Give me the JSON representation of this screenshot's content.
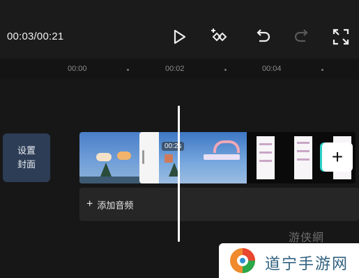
{
  "toolbar": {
    "timecode": "00:03/00:21",
    "icons": [
      "play-icon",
      "keyframe-add-icon",
      "undo-icon",
      "redo-icon",
      "fullscreen-icon"
    ]
  },
  "ruler": {
    "labels": [
      "00:00",
      "00:02",
      "00:04"
    ]
  },
  "cover": {
    "line1": "设置",
    "line2": "封面"
  },
  "video_track": {
    "duration_badge": "00:2s",
    "add_label": "+"
  },
  "audio_track": {
    "plus": "+",
    "label": "添加音频"
  },
  "watermarks": {
    "small": "游侠網",
    "brand": "道宁手游网"
  },
  "colors": {
    "background": "#171717",
    "cover_button": "#2d3d56",
    "selection_border": "#f5f5f5",
    "accent_cyan": "#2ad1c9"
  }
}
